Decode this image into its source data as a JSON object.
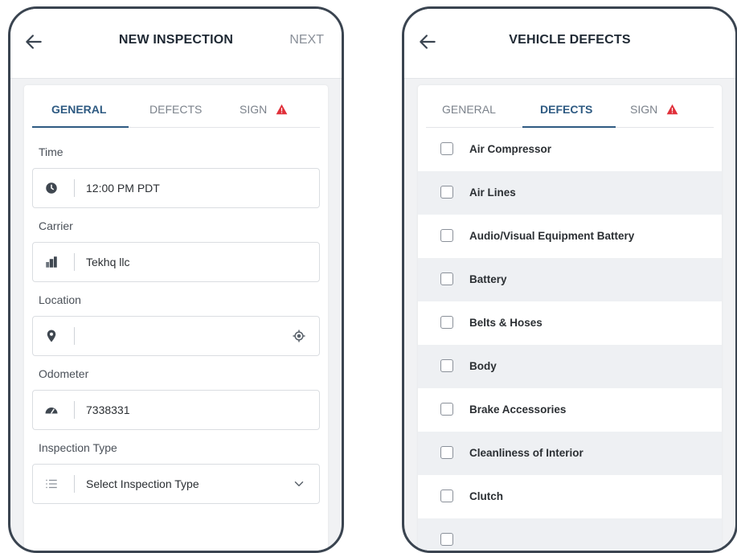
{
  "left_screen": {
    "header": {
      "title": "NEW INSPECTION",
      "next_label": "NEXT"
    },
    "tabs": [
      {
        "label": "GENERAL",
        "active": true
      },
      {
        "label": "DEFECTS",
        "active": false
      },
      {
        "label": "SIGN",
        "active": false,
        "warning": true
      }
    ],
    "fields": {
      "time": {
        "label": "Time",
        "value": "12:00 PM PDT",
        "icon": "clock-icon"
      },
      "carrier": {
        "label": "Carrier",
        "value": "Tekhq llc",
        "icon": "building-icon"
      },
      "location": {
        "label": "Location",
        "value": "",
        "icon": "map-pin-icon",
        "action_icon": "locate-icon"
      },
      "odometer": {
        "label": "Odometer",
        "value": "7338331",
        "icon": "speedometer-icon"
      },
      "inspection_type": {
        "label": "Inspection Type",
        "placeholder": "Select Inspection Type",
        "icon": "list-icon",
        "action_icon": "chevron-down-icon"
      }
    }
  },
  "right_screen": {
    "header": {
      "title": "VEHICLE DEFECTS"
    },
    "tabs": [
      {
        "label": "GENERAL",
        "active": false
      },
      {
        "label": "DEFECTS",
        "active": true
      },
      {
        "label": "SIGN",
        "active": false,
        "warning": true
      }
    ],
    "defects": [
      "Air Compressor",
      "Air Lines",
      "Audio/Visual Equipment Battery",
      "Battery",
      "Belts & Hoses",
      "Body",
      "Brake Accessories",
      "Cleanliness of Interior",
      "Clutch"
    ]
  },
  "colors": {
    "accent": "#2e5a82",
    "warning": "#e0303a",
    "frame": "#3a4450"
  }
}
